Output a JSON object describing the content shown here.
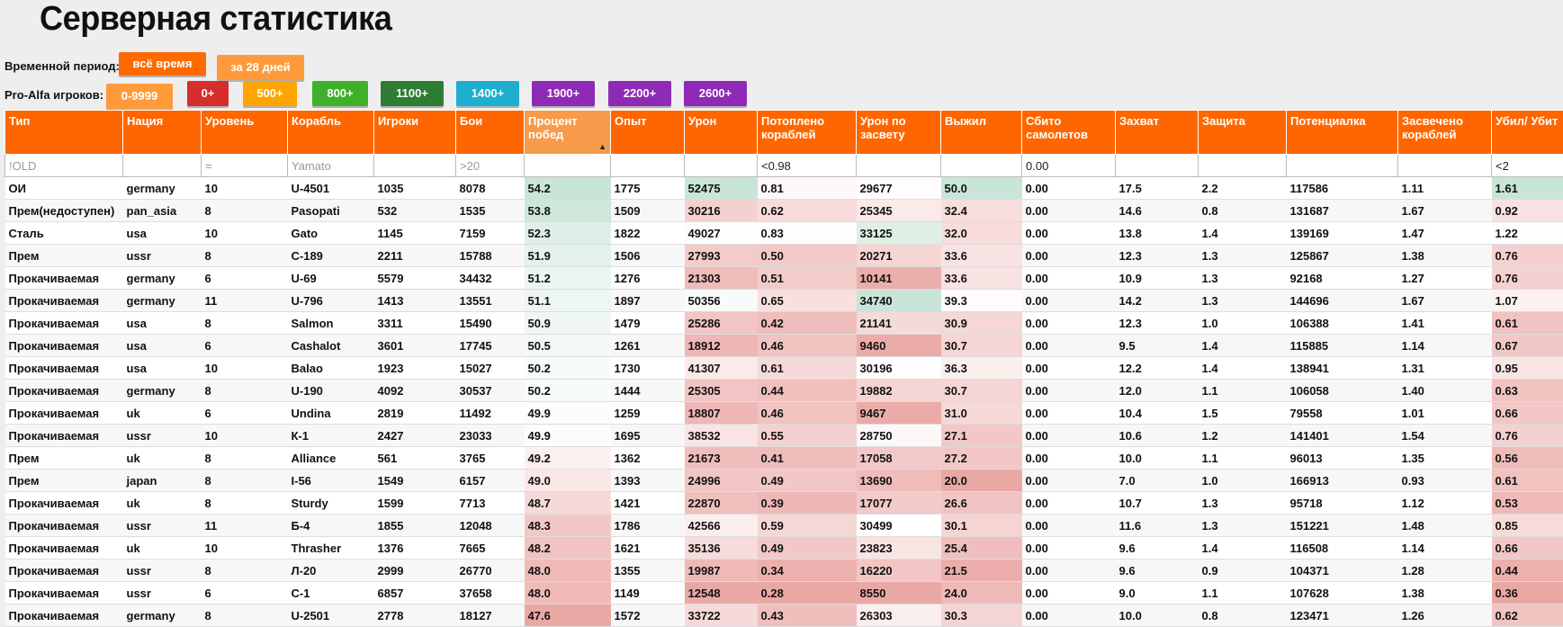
{
  "page_title": "Серверная статистика",
  "period": {
    "label": "Временной период:",
    "buttons": [
      {
        "label": "всё время",
        "color": "#ff6a00"
      },
      {
        "label": "за 28 дней",
        "color": "#ff9a3a"
      }
    ]
  },
  "alfa": {
    "label": "Pro-Alfa игроков:",
    "buttons": [
      {
        "label": "0-9999",
        "color": "#ff9a3a"
      },
      {
        "label": "0+",
        "color": "#d62d2d"
      },
      {
        "label": "500+",
        "color": "#ffa500"
      },
      {
        "label": "800+",
        "color": "#3fb02a"
      },
      {
        "label": "1100+",
        "color": "#2e7d32"
      },
      {
        "label": "1400+",
        "color": "#1eaed0"
      },
      {
        "label": "1900+",
        "color": "#8e2ab5"
      },
      {
        "label": "2200+",
        "color": "#8e2ab5"
      },
      {
        "label": "2600+",
        "color": "#8e2ab5"
      }
    ]
  },
  "table": {
    "columns": [
      "Тип",
      "Нация",
      "Уровень",
      "Корабль",
      "Игроки",
      "Бои",
      "Процент побед",
      "Опыт",
      "Урон",
      "Потоплено кораблей",
      "Урон по засвету",
      "Выжил",
      "Сбито самолетов",
      "Захват",
      "Защита",
      "Потенциалка",
      "Засвечено кораблей",
      "Убил/ Убит"
    ],
    "filters": [
      {
        "value": "",
        "placeholder": "!OLD"
      },
      {
        "value": "",
        "placeholder": ""
      },
      {
        "value": "",
        "placeholder": "="
      },
      {
        "value": "",
        "placeholder": "Yamato"
      },
      {
        "value": "",
        "placeholder": ""
      },
      {
        "value": "",
        "placeholder": ">20"
      },
      {
        "value": "",
        "placeholder": ""
      },
      {
        "value": "",
        "placeholder": ""
      },
      {
        "value": "",
        "placeholder": ""
      },
      {
        "value": "<0.98",
        "placeholder": ""
      },
      {
        "value": "",
        "placeholder": ""
      },
      {
        "value": "",
        "placeholder": ""
      },
      {
        "value": "0.00",
        "placeholder": ""
      },
      {
        "value": "",
        "placeholder": ""
      },
      {
        "value": "",
        "placeholder": ""
      },
      {
        "value": "",
        "placeholder": ""
      },
      {
        "value": "",
        "placeholder": ""
      },
      {
        "value": "<2",
        "placeholder": ""
      }
    ],
    "rows": [
      [
        "ОИ",
        "germany",
        "10",
        "U-4501",
        "1035",
        "8078",
        "54.2",
        "1775",
        "52475",
        "0.81",
        "29677",
        "50.0",
        "0.00",
        "17.5",
        "2.2",
        "117586",
        "1.11",
        "1.61"
      ],
      [
        "Прем(недоступен)",
        "pan_asia",
        "8",
        "Pasopati",
        "532",
        "1535",
        "53.8",
        "1509",
        "30216",
        "0.62",
        "25345",
        "32.4",
        "0.00",
        "14.6",
        "0.8",
        "131687",
        "1.67",
        "0.92"
      ],
      [
        "Сталь",
        "usa",
        "10",
        "Gato",
        "1145",
        "7159",
        "52.3",
        "1822",
        "49027",
        "0.83",
        "33125",
        "32.0",
        "0.00",
        "13.8",
        "1.4",
        "139169",
        "1.47",
        "1.22"
      ],
      [
        "Прем",
        "ussr",
        "8",
        "С-189",
        "2211",
        "15788",
        "51.9",
        "1506",
        "27993",
        "0.50",
        "20271",
        "33.6",
        "0.00",
        "12.3",
        "1.3",
        "125867",
        "1.38",
        "0.76"
      ],
      [
        "Прокачиваемая",
        "germany",
        "6",
        "U-69",
        "5579",
        "34432",
        "51.2",
        "1276",
        "21303",
        "0.51",
        "10141",
        "33.6",
        "0.00",
        "10.9",
        "1.3",
        "92168",
        "1.27",
        "0.76"
      ],
      [
        "Прокачиваемая",
        "germany",
        "11",
        "U-796",
        "1413",
        "13551",
        "51.1",
        "1897",
        "50356",
        "0.65",
        "34740",
        "39.3",
        "0.00",
        "14.2",
        "1.3",
        "144696",
        "1.67",
        "1.07"
      ],
      [
        "Прокачиваемая",
        "usa",
        "8",
        "Salmon",
        "3311",
        "15490",
        "50.9",
        "1479",
        "25286",
        "0.42",
        "21141",
        "30.9",
        "0.00",
        "12.3",
        "1.0",
        "106388",
        "1.41",
        "0.61"
      ],
      [
        "Прокачиваемая",
        "usa",
        "6",
        "Cashalot",
        "3601",
        "17745",
        "50.5",
        "1261",
        "18912",
        "0.46",
        "9460",
        "30.7",
        "0.00",
        "9.5",
        "1.4",
        "115885",
        "1.14",
        "0.67"
      ],
      [
        "Прокачиваемая",
        "usa",
        "10",
        "Balao",
        "1923",
        "15027",
        "50.2",
        "1730",
        "41307",
        "0.61",
        "30196",
        "36.3",
        "0.00",
        "12.2",
        "1.4",
        "138941",
        "1.31",
        "0.95"
      ],
      [
        "Прокачиваемая",
        "germany",
        "8",
        "U-190",
        "4092",
        "30537",
        "50.2",
        "1444",
        "25305",
        "0.44",
        "19882",
        "30.7",
        "0.00",
        "12.0",
        "1.1",
        "106058",
        "1.40",
        "0.63"
      ],
      [
        "Прокачиваемая",
        "uk",
        "6",
        "Undina",
        "2819",
        "11492",
        "49.9",
        "1259",
        "18807",
        "0.46",
        "9467",
        "31.0",
        "0.00",
        "10.4",
        "1.5",
        "79558",
        "1.01",
        "0.66"
      ],
      [
        "Прокачиваемая",
        "ussr",
        "10",
        "К-1",
        "2427",
        "23033",
        "49.9",
        "1695",
        "38532",
        "0.55",
        "28750",
        "27.1",
        "0.00",
        "10.6",
        "1.2",
        "141401",
        "1.54",
        "0.76"
      ],
      [
        "Прем",
        "uk",
        "8",
        "Alliance",
        "561",
        "3765",
        "49.2",
        "1362",
        "21673",
        "0.41",
        "17058",
        "27.2",
        "0.00",
        "10.0",
        "1.1",
        "96013",
        "1.35",
        "0.56"
      ],
      [
        "Прем",
        "japan",
        "8",
        "I-56",
        "1549",
        "6157",
        "49.0",
        "1393",
        "24996",
        "0.49",
        "13690",
        "20.0",
        "0.00",
        "7.0",
        "1.0",
        "166913",
        "0.93",
        "0.61"
      ],
      [
        "Прокачиваемая",
        "uk",
        "8",
        "Sturdy",
        "1599",
        "7713",
        "48.7",
        "1421",
        "22870",
        "0.39",
        "17077",
        "26.6",
        "0.00",
        "10.7",
        "1.3",
        "95718",
        "1.12",
        "0.53"
      ],
      [
        "Прокачиваемая",
        "ussr",
        "11",
        "Б-4",
        "1855",
        "12048",
        "48.3",
        "1786",
        "42566",
        "0.59",
        "30499",
        "30.1",
        "0.00",
        "11.6",
        "1.3",
        "151221",
        "1.48",
        "0.85"
      ],
      [
        "Прокачиваемая",
        "uk",
        "10",
        "Thrasher",
        "1376",
        "7665",
        "48.2",
        "1621",
        "35136",
        "0.49",
        "23823",
        "25.4",
        "0.00",
        "9.6",
        "1.4",
        "116508",
        "1.14",
        "0.66"
      ],
      [
        "Прокачиваемая",
        "ussr",
        "8",
        "Л-20",
        "2999",
        "26770",
        "48.0",
        "1355",
        "19987",
        "0.34",
        "16220",
        "21.5",
        "0.00",
        "9.6",
        "0.9",
        "104371",
        "1.28",
        "0.44"
      ],
      [
        "Прокачиваемая",
        "ussr",
        "6",
        "С-1",
        "6857",
        "37658",
        "48.0",
        "1149",
        "12548",
        "0.28",
        "8550",
        "24.0",
        "0.00",
        "9.0",
        "1.1",
        "107628",
        "1.38",
        "0.36"
      ],
      [
        "Прокачиваемая",
        "germany",
        "8",
        "U-2501",
        "2778",
        "18127",
        "47.6",
        "1572",
        "33722",
        "0.43",
        "26303",
        "30.3",
        "0.00",
        "10.0",
        "0.8",
        "123471",
        "1.26",
        "0.62"
      ]
    ],
    "tint": {
      "good_color": "#c3e2d2",
      "bad_color": "#e9a3a0",
      "neutral_color": "#ffffff"
    }
  }
}
